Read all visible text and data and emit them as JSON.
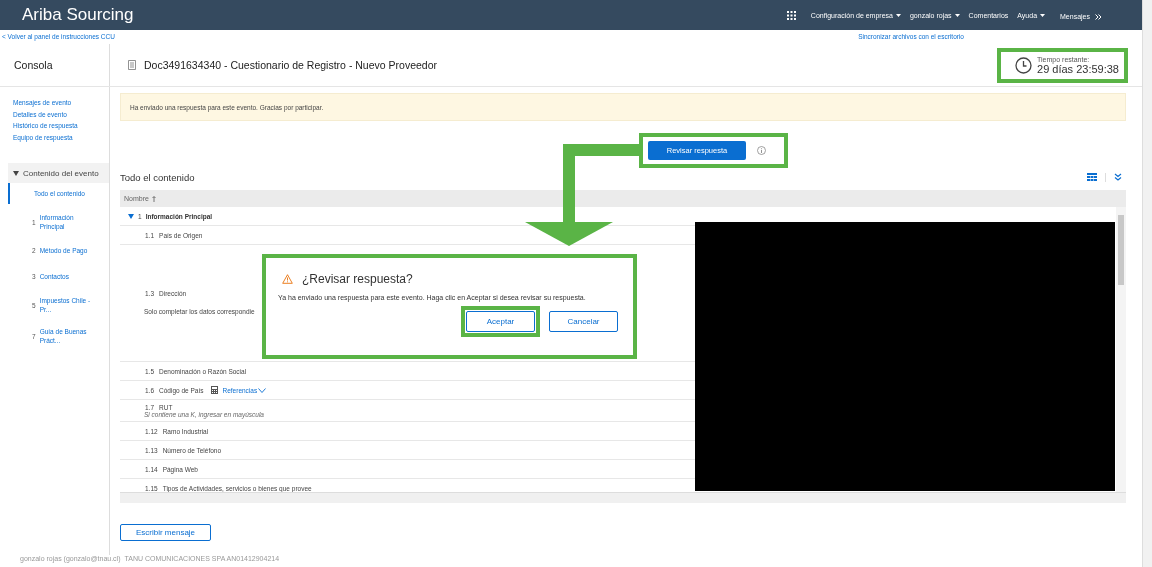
{
  "header": {
    "brand": "Ariba Sourcing",
    "menu": [
      {
        "label": "Configuración de empresa",
        "dropdown": true
      },
      {
        "label": "gonzalo rojas",
        "dropdown": true
      },
      {
        "label": "Comentarios",
        "dropdown": false
      },
      {
        "label": "Ayuda",
        "dropdown": true
      }
    ],
    "messages": "Mensajes"
  },
  "back_link": "< Volver al panel de instrucciones CCU",
  "sync_link": "Sincronizar archivos con el escritorio",
  "sidebar": {
    "title": "Consola",
    "links": [
      "Mensajes de evento",
      "Detalles de evento",
      "Histórico de respuesta",
      "Equipo de respuesta"
    ],
    "section": {
      "label": "Contenido del evento",
      "expanded": true
    },
    "items": [
      {
        "label": "Todo el contenido",
        "selected": true
      },
      {
        "number": "1",
        "label": "Información Principal",
        "selected": false
      },
      {
        "number": "2",
        "label": "Método de Pago",
        "selected": false
      },
      {
        "number": "3",
        "label": "Contactos",
        "selected": false
      },
      {
        "number": "5",
        "label": "Impuestos Chile - Pr...",
        "selected": false
      },
      {
        "number": "7",
        "label": "Guía de Buenas Práct...",
        "selected": false
      }
    ]
  },
  "document": {
    "title": "Doc3491634340 - Cuestionario de Registro - Nuevo Proveedor"
  },
  "timer": {
    "label": "Tiempo restante:",
    "value": "29 días 23:59:38"
  },
  "notice": "Ha enviado una respuesta para este evento. Gracias por participar.",
  "review_button": "Revisar respuesta",
  "content": {
    "title": "Todo el contenido",
    "column": "Nombre",
    "rows": [
      {
        "kind": "section",
        "number": "1",
        "label": "Información Principal",
        "expanded": true
      },
      {
        "kind": "question",
        "number": "1.1",
        "label": "País de Origen"
      },
      {
        "kind": "tall",
        "number": "1.3",
        "label": "Dirección",
        "note": "Solo completar los datos correspondie"
      },
      {
        "kind": "question",
        "number": "1.5",
        "label": "Denominación o Razón Social"
      },
      {
        "kind": "reference",
        "number": "1.6",
        "label": "Código de País",
        "link": "Referencias"
      },
      {
        "kind": "hint",
        "number": "1.7",
        "label": "RUT",
        "hint": "Si contiene una K, ingresar en mayúscula"
      },
      {
        "kind": "question",
        "number": "1.12",
        "label": "Ramo Industrial"
      },
      {
        "kind": "question",
        "number": "1.13",
        "label": "Número de Teléfono"
      },
      {
        "kind": "question",
        "number": "1.14",
        "label": "Página Web"
      },
      {
        "kind": "question",
        "number": "1.15",
        "label": "Tipos de Actividades, servicios o bienes que provee"
      }
    ]
  },
  "dialog": {
    "title": "¿Revisar respuesta?",
    "message": "Ya ha enviado una respuesta para este evento. Haga clic en Aceptar si desea revisar su respuesta.",
    "buttons": [
      {
        "label": "Aceptar",
        "highlighted": true
      },
      {
        "label": "Cancelar",
        "highlighted": false
      }
    ]
  },
  "write_button": "Escribir mensaje",
  "footer": {
    "user": "gonzalo rojas (gonzalo@tnau.cl)",
    "company": "TANU COMUNICACIONES SPA  AN01412904214"
  }
}
